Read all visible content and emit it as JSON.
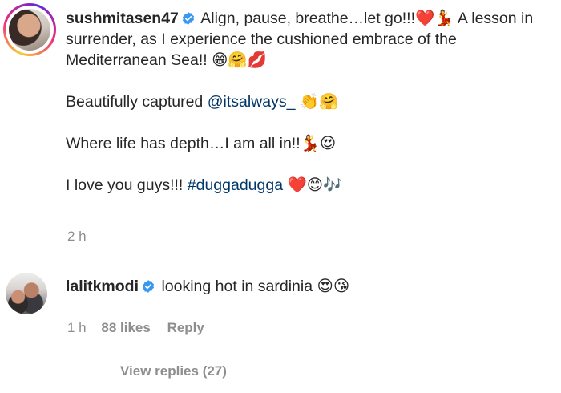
{
  "comments": [
    {
      "username": "sushmitasen47",
      "verified": true,
      "paragraphs": [
        {
          "text": "Align, pause, breathe…let go!!!❤️💃 A lesson in surrender, as I experience the cushioned embrace of the Mediterranean Sea!! 😁🤗💋"
        },
        {
          "prefix": "Beautifully captured ",
          "mention": "@itsalways_",
          "suffix": " 👏🤗"
        },
        {
          "text": "Where life has depth…I am all in!!💃😍"
        },
        {
          "prefix": "I love you guys!!! ",
          "hashtag": "#duggadugga",
          "suffix": " ❤️😊🎶"
        }
      ],
      "time": "2 h"
    },
    {
      "username": "lalitkmodi",
      "verified": true,
      "text": "looking hot in sardinia 😍😘",
      "time": "1 h",
      "likes": "88 likes",
      "reply_label": "Reply",
      "view_replies": "View replies (27)"
    }
  ],
  "colors": {
    "text": "#262626",
    "secondary": "#8e8e8e",
    "link": "#00376b",
    "verified": "#3897f0"
  }
}
